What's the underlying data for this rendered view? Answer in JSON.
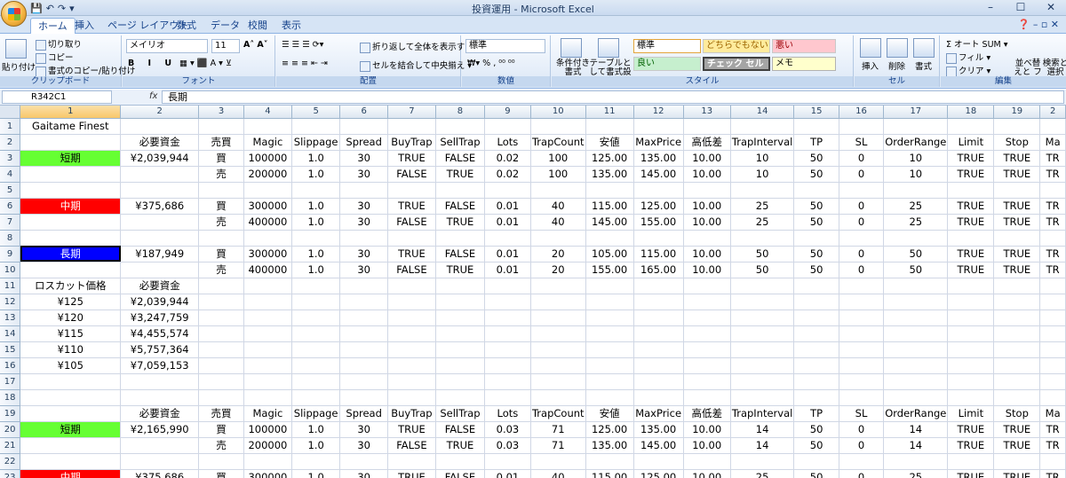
{
  "window": {
    "title": "投資運用 - Microsoft Excel",
    "controls": [
      "–",
      "☐",
      "✕"
    ]
  },
  "qat": [
    "💾",
    "↶",
    "↷",
    "▾"
  ],
  "tabs": [
    "ホーム",
    "挿入",
    "ページ レイアウト",
    "数式",
    "データ",
    "校閲",
    "表示"
  ],
  "ribbon": {
    "clipboard": {
      "label": "クリップボード",
      "paste": "貼り付け",
      "cut": "切り取り",
      "copy": "コピー",
      "format_painter": "書式のコピー/貼り付け"
    },
    "font": {
      "label": "フォント",
      "name": "メイリオ",
      "size": "11"
    },
    "alignment": {
      "label": "配置",
      "wrap": "折り返して全体を表示する",
      "merge": "セルを結合して中央揃え"
    },
    "number": {
      "label": "数値",
      "format": "標準"
    },
    "styles": {
      "label": "スタイル",
      "conditional": "条件付き書式",
      "as_table": "テーブルとして書式設定",
      "cells": [
        "標準",
        "どちらでもない",
        "悪い",
        "良い",
        "チェック セル",
        "メモ"
      ]
    },
    "cells_group": {
      "label": "セル",
      "insert": "挿入",
      "delete": "削除",
      "format": "書式"
    },
    "editing": {
      "label": "編集",
      "autosum": "オート SUM",
      "fill": "フィル",
      "clear": "クリア",
      "sort": "並べ替えと フィルタ",
      "find": "検索と 選択"
    }
  },
  "formula_bar": {
    "name_box": "R342C1",
    "fx": "fx",
    "value": "長期"
  },
  "colors": {
    "green": "#66ff33",
    "red": "#ff0000",
    "blue": "#0000ff"
  },
  "columns": [
    "1",
    "2",
    "3",
    "4",
    "5",
    "6",
    "7",
    "8",
    "9",
    "10",
    "11",
    "12",
    "13",
    "14",
    "15",
    "16",
    "17",
    "18",
    "19",
    "2"
  ],
  "rows": [
    [
      "Gaitame Finest",
      "",
      "",
      "",
      "",
      "",
      "",
      "",
      "",
      "",
      "",
      "",
      "",
      "",
      "",
      "",
      "",
      "",
      "",
      ""
    ],
    [
      "",
      "必要資金",
      "売買",
      "Magic",
      "Slippage",
      "Spread",
      "BuyTrap",
      "SellTrap",
      "Lots",
      "TrapCount",
      "安値",
      "MaxPrice",
      "高低差",
      "TrapInterval",
      "TP",
      "SL",
      "OrderRange",
      "Limit",
      "Stop",
      "Ma"
    ],
    [
      "短期",
      "¥2,039,944",
      "買",
      "100000",
      "1.0",
      "30",
      "TRUE",
      "FALSE",
      "0.02",
      "100",
      "125.00",
      "135.00",
      "10.00",
      "10",
      "50",
      "0",
      "10",
      "TRUE",
      "TRUE",
      "TR"
    ],
    [
      "",
      "",
      "売",
      "200000",
      "1.0",
      "30",
      "FALSE",
      "TRUE",
      "0.02",
      "100",
      "135.00",
      "145.00",
      "10.00",
      "10",
      "50",
      "0",
      "10",
      "TRUE",
      "TRUE",
      "TR"
    ],
    [
      "",
      "",
      "",
      "",
      "",
      "",
      "",
      "",
      "",
      "",
      "",
      "",
      "",
      "",
      "",
      "",
      "",
      "",
      "",
      ""
    ],
    [
      "中期",
      "¥375,686",
      "買",
      "300000",
      "1.0",
      "30",
      "TRUE",
      "FALSE",
      "0.01",
      "40",
      "115.00",
      "125.00",
      "10.00",
      "25",
      "50",
      "0",
      "25",
      "TRUE",
      "TRUE",
      "TR"
    ],
    [
      "",
      "",
      "売",
      "400000",
      "1.0",
      "30",
      "FALSE",
      "TRUE",
      "0.01",
      "40",
      "145.00",
      "155.00",
      "10.00",
      "25",
      "50",
      "0",
      "25",
      "TRUE",
      "TRUE",
      "TR"
    ],
    [
      "",
      "",
      "",
      "",
      "",
      "",
      "",
      "",
      "",
      "",
      "",
      "",
      "",
      "",
      "",
      "",
      "",
      "",
      "",
      ""
    ],
    [
      "長期",
      "¥187,949",
      "買",
      "300000",
      "1.0",
      "30",
      "TRUE",
      "FALSE",
      "0.01",
      "20",
      "105.00",
      "115.00",
      "10.00",
      "50",
      "50",
      "0",
      "50",
      "TRUE",
      "TRUE",
      "TR"
    ],
    [
      "",
      "",
      "売",
      "400000",
      "1.0",
      "30",
      "FALSE",
      "TRUE",
      "0.01",
      "20",
      "155.00",
      "165.00",
      "10.00",
      "50",
      "50",
      "0",
      "50",
      "TRUE",
      "TRUE",
      "TR"
    ],
    [
      "ロスカット価格",
      "必要資金",
      "",
      "",
      "",
      "",
      "",
      "",
      "",
      "",
      "",
      "",
      "",
      "",
      "",
      "",
      "",
      "",
      "",
      ""
    ],
    [
      "¥125",
      "¥2,039,944",
      "",
      "",
      "",
      "",
      "",
      "",
      "",
      "",
      "",
      "",
      "",
      "",
      "",
      "",
      "",
      "",
      "",
      ""
    ],
    [
      "¥120",
      "¥3,247,759",
      "",
      "",
      "",
      "",
      "",
      "",
      "",
      "",
      "",
      "",
      "",
      "",
      "",
      "",
      "",
      "",
      "",
      ""
    ],
    [
      "¥115",
      "¥4,455,574",
      "",
      "",
      "",
      "",
      "",
      "",
      "",
      "",
      "",
      "",
      "",
      "",
      "",
      "",
      "",
      "",
      "",
      ""
    ],
    [
      "¥110",
      "¥5,757,364",
      "",
      "",
      "",
      "",
      "",
      "",
      "",
      "",
      "",
      "",
      "",
      "",
      "",
      "",
      "",
      "",
      "",
      ""
    ],
    [
      "¥105",
      "¥7,059,153",
      "",
      "",
      "",
      "",
      "",
      "",
      "",
      "",
      "",
      "",
      "",
      "",
      "",
      "",
      "",
      "",
      "",
      ""
    ],
    [
      "",
      "",
      "",
      "",
      "",
      "",
      "",
      "",
      "",
      "",
      "",
      "",
      "",
      "",
      "",
      "",
      "",
      "",
      "",
      ""
    ],
    [
      "",
      "",
      "",
      "",
      "",
      "",
      "",
      "",
      "",
      "",
      "",
      "",
      "",
      "",
      "",
      "",
      "",
      "",
      "",
      ""
    ],
    [
      "",
      "必要資金",
      "売買",
      "Magic",
      "Slippage",
      "Spread",
      "BuyTrap",
      "SellTrap",
      "Lots",
      "TrapCount",
      "安値",
      "MaxPrice",
      "高低差",
      "TrapInterval",
      "TP",
      "SL",
      "OrderRange",
      "Limit",
      "Stop",
      "Ma"
    ],
    [
      "短期",
      "¥2,165,990",
      "買",
      "100000",
      "1.0",
      "30",
      "TRUE",
      "FALSE",
      "0.03",
      "71",
      "125.00",
      "135.00",
      "10.00",
      "14",
      "50",
      "0",
      "14",
      "TRUE",
      "TRUE",
      "TR"
    ],
    [
      "",
      "",
      "売",
      "200000",
      "1.0",
      "30",
      "FALSE",
      "TRUE",
      "0.03",
      "71",
      "135.00",
      "145.00",
      "10.00",
      "14",
      "50",
      "0",
      "14",
      "TRUE",
      "TRUE",
      "TR"
    ],
    [
      "",
      "",
      "",
      "",
      "",
      "",
      "",
      "",
      "",
      "",
      "",
      "",
      "",
      "",
      "",
      "",
      "",
      "",
      "",
      ""
    ],
    [
      "中期",
      "¥375,686",
      "買",
      "300000",
      "1.0",
      "30",
      "TRUE",
      "FALSE",
      "0.01",
      "40",
      "115.00",
      "125.00",
      "10.00",
      "25",
      "50",
      "0",
      "25",
      "TRUE",
      "TRUE",
      "TR"
    ]
  ],
  "row_numbers": [
    "1",
    "2",
    "3",
    "4",
    "5",
    "6",
    "7",
    "8",
    "9",
    "10",
    "11",
    "12",
    "13",
    "14",
    "15",
    "16",
    "17",
    "18",
    "19",
    "20",
    "21",
    "22",
    "23"
  ],
  "cell_fills": {
    "短期": "green",
    "中期": "red",
    "長期": "blue"
  }
}
